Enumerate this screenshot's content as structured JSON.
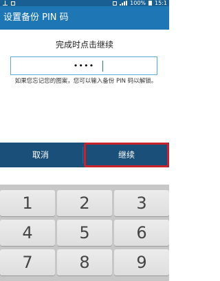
{
  "status_bar": {
    "battery": "100%",
    "time": "15:1"
  },
  "title_bar": {
    "title": "设置备份 PIN 码"
  },
  "content": {
    "prompt": "完成时点击继续",
    "pin_value": "••••",
    "hint": "如果您忘记您的图案，您可以输入备份 PIN 码以解锁。"
  },
  "actions": {
    "cancel_label": "取消",
    "continue_label": "继续"
  },
  "keypad": {
    "keys": [
      "1",
      "2",
      "3",
      "4",
      "5",
      "6",
      "7",
      "8",
      "9"
    ]
  }
}
